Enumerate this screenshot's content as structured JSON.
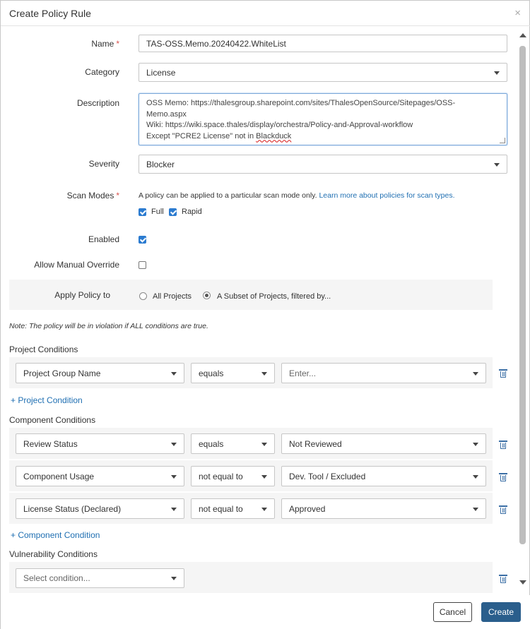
{
  "dialog": {
    "title": "Create Policy Rule",
    "close_glyph": "×"
  },
  "form": {
    "name": {
      "label": "Name",
      "required": "*",
      "value": "TAS-OSS.Memo.20240422.WhiteList"
    },
    "category": {
      "label": "Category",
      "value": "License"
    },
    "description": {
      "label": "Description",
      "lines": [
        "OSS Memo: https://thalesgroup.sharepoint.com/sites/ThalesOpenSource/Sitepages/OSS-",
        "Memo.aspx",
        "Wiki: https://wiki.space.thales/display/orchestra/Policy-and-Approval-workflow"
      ],
      "last_line_prefix": "Except \"PCRE2 License\" not in ",
      "last_line_misspelled": "Blackduck"
    },
    "severity": {
      "label": "Severity",
      "value": "Blocker"
    },
    "scan_modes": {
      "label": "Scan Modes",
      "required": "*",
      "help_text": "A policy can be applied to a particular scan mode only.",
      "help_link": "Learn more about policies for scan types.",
      "options": [
        {
          "label": "Full",
          "checked": true
        },
        {
          "label": "Rapid",
          "checked": true
        }
      ]
    },
    "enabled": {
      "label": "Enabled",
      "checked": true
    },
    "allow_manual_override": {
      "label": "Allow Manual Override",
      "checked": false
    },
    "apply_policy_to": {
      "label": "Apply Policy to",
      "options": [
        {
          "label": "All Projects",
          "selected": false
        },
        {
          "label": "A Subset of Projects, filtered by...",
          "selected": true
        }
      ]
    }
  },
  "note": "Note: The policy will be in violation if ALL conditions are true.",
  "project_conditions": {
    "heading": "Project Conditions",
    "rows": [
      {
        "field": "Project Group Name",
        "operator": "equals",
        "value": "Enter..."
      }
    ],
    "add_label": "+ Project Condition"
  },
  "component_conditions": {
    "heading": "Component Conditions",
    "rows": [
      {
        "field": "Review Status",
        "operator": "equals",
        "value": "Not Reviewed"
      },
      {
        "field": "Component Usage",
        "operator": "not equal to",
        "value": "Dev. Tool / Excluded"
      },
      {
        "field": "License Status (Declared)",
        "operator": "not equal to",
        "value": "Approved"
      }
    ],
    "add_label": "+ Component Condition"
  },
  "vulnerability_conditions": {
    "heading": "Vulnerability Conditions",
    "select_placeholder": "Select condition..."
  },
  "footer": {
    "cancel_label": "Cancel",
    "create_label": "Create"
  },
  "colors": {
    "primary_button": "#2a5e8c",
    "link": "#1f6fb2",
    "checkbox": "#2b7bd0",
    "required": "#d9534f"
  }
}
